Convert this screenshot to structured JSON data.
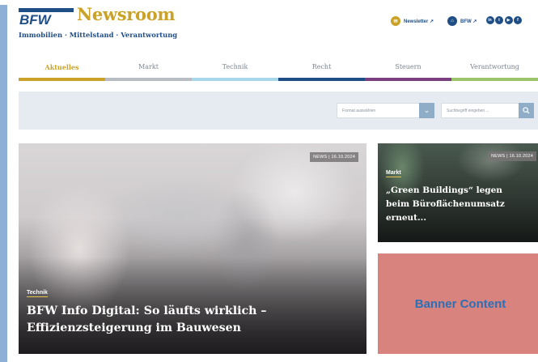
{
  "header": {
    "logo_text": "BFW",
    "brand": "Newsroom",
    "tagline": "Immobilien · Mittelstand · Verantwortung",
    "newsletter_label": "Newsletter ↗",
    "bfw_label": "BFW ↗",
    "social": [
      "in",
      "tw",
      "yt",
      "fb"
    ]
  },
  "nav": {
    "items": [
      {
        "label": "Aktuelles",
        "color": "#c9a227"
      },
      {
        "label": "Markt",
        "color": "#b8bcc3"
      },
      {
        "label": "Technik",
        "color": "#a9d6e9"
      },
      {
        "label": "Recht",
        "color": "#1f4d86"
      },
      {
        "label": "Steuern",
        "color": "#7a3f7f"
      },
      {
        "label": "Verantwortung",
        "color": "#9bc46b"
      }
    ]
  },
  "filter": {
    "format_placeholder": "Format auswählen",
    "search_placeholder": "Suchbegriff eingeben ..."
  },
  "hero": {
    "badge": "NEWS | 16.10.2024",
    "category": "Technik",
    "title_line1": "BFW Info Digital: So läufts wirklich –",
    "title_line2": "Effizienzsteigerung im Bauwesen"
  },
  "side_card": {
    "badge": "NEWS | 16.10.2024",
    "category": "Markt",
    "title_line1": "„Green Buildings“ legen",
    "title_line2": "beim Büroflächenumsatz",
    "title_line3": "erneut..."
  },
  "banner": {
    "label": "Banner Content"
  },
  "colors": {
    "brand_gold": "#c9a227",
    "brand_blue": "#1f4d86",
    "banner_bg": "#d9837f"
  }
}
